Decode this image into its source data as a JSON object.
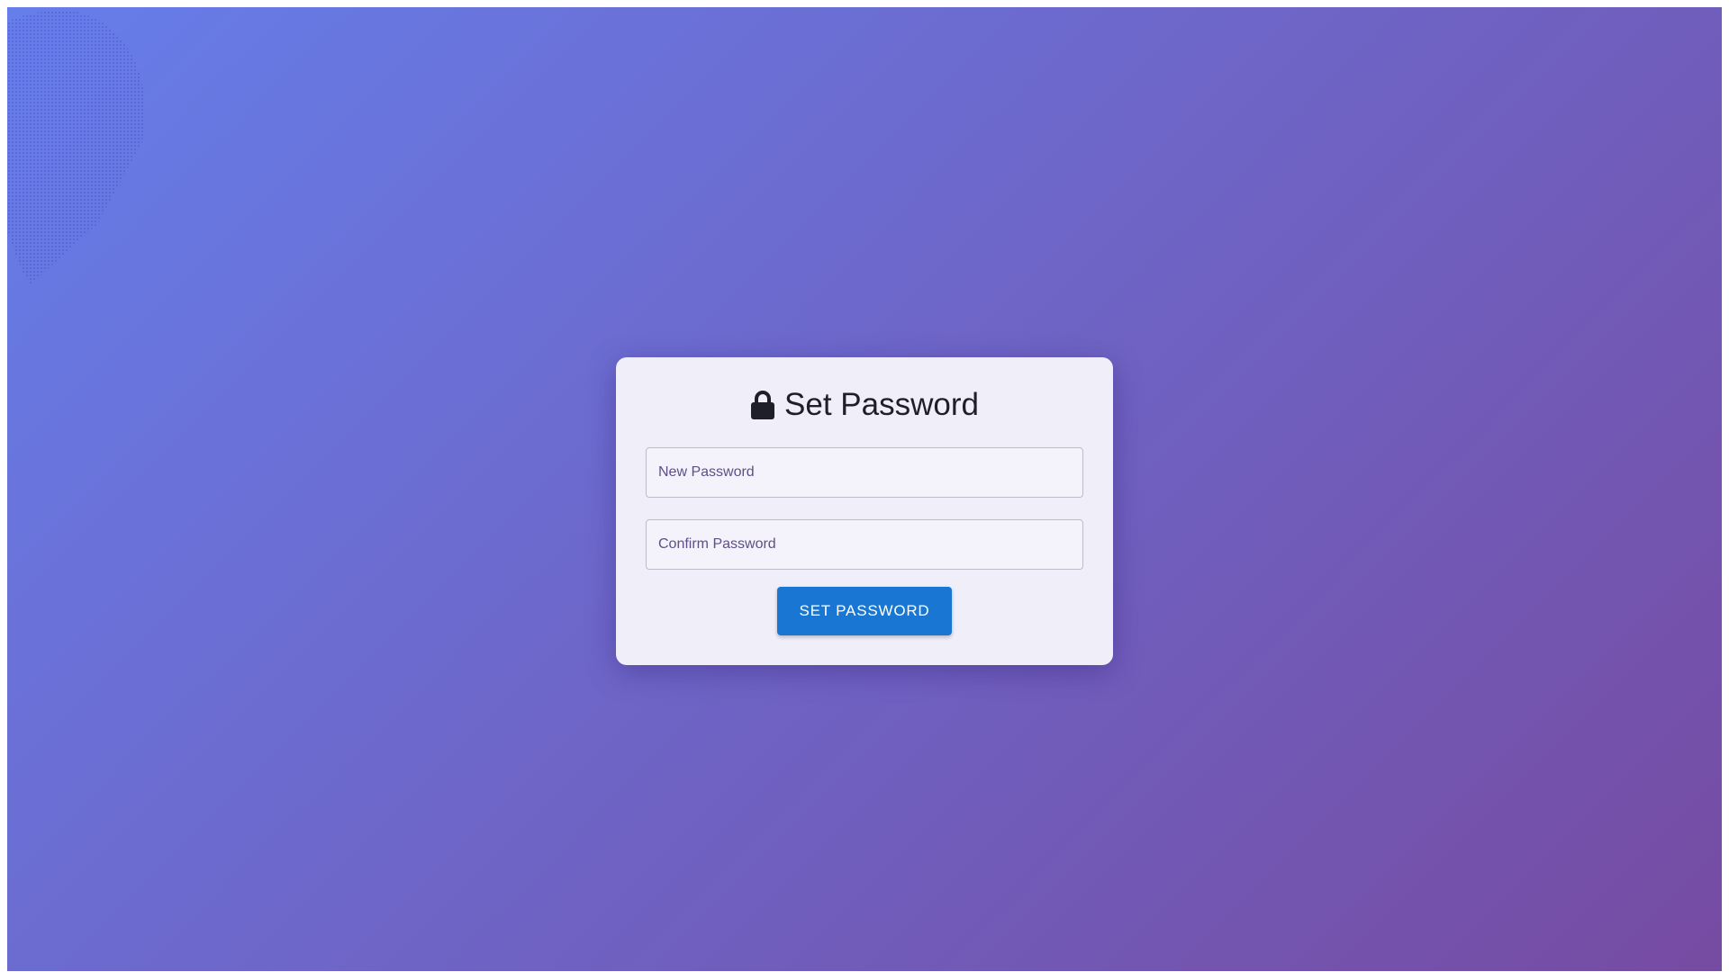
{
  "page": {
    "background_gradient": [
      "#667eea",
      "#764ba2"
    ]
  },
  "card": {
    "title": "Set Password",
    "title_icon": "lock-icon",
    "new_password_placeholder": "New Password",
    "confirm_password_placeholder": "Confirm Password",
    "submit_label": "SET PASSWORD"
  },
  "colors": {
    "card_background": "#f0eff9",
    "button": "#1976d2",
    "button_text": "#ffffff",
    "title_text": "#1f1f2a"
  }
}
